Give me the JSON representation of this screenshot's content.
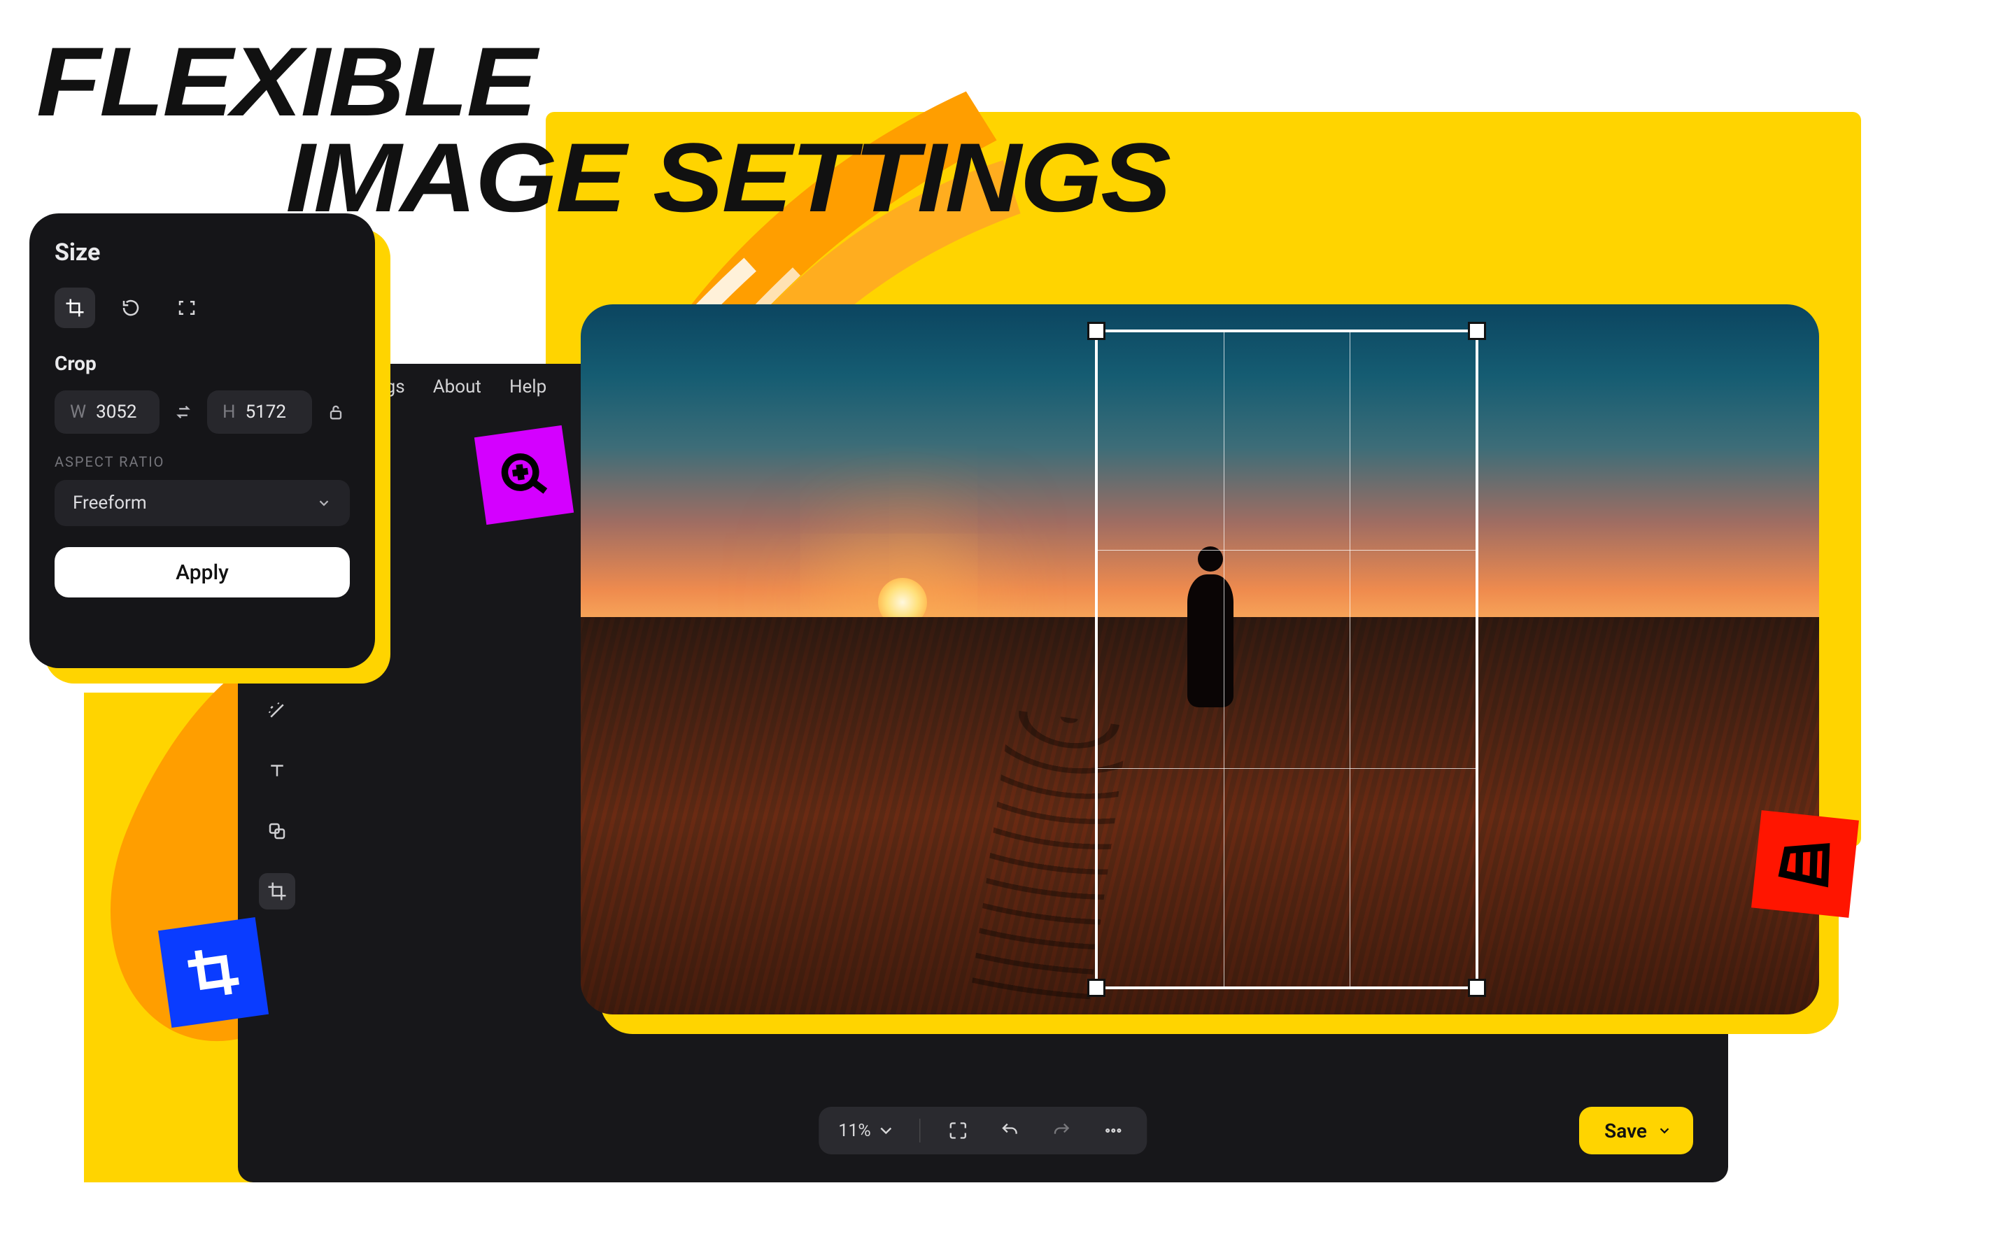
{
  "headline": {
    "line1": "FLEXIBLE",
    "line2": "IMAGE SETTINGS"
  },
  "editor": {
    "menu": {
      "settings": "ings",
      "about": "About",
      "help": "Help"
    },
    "zoom": "11%",
    "save_label": "Save"
  },
  "size_panel": {
    "title": "Size",
    "crop_label": "Crop",
    "width_label": "W",
    "width_value": "3052",
    "height_label": "H",
    "height_value": "5172",
    "aspect_ratio_label": "ASPECT RATIO",
    "aspect_ratio_value": "Freeform",
    "apply_label": "Apply"
  },
  "icons": {
    "crop": "crop-icon",
    "rotate": "rotate-icon",
    "fullscreen": "fullscreen-icon",
    "swap": "swap-icon",
    "lock": "lock-icon",
    "magic": "magic-icon",
    "text": "text-icon",
    "shape": "shape-icon",
    "zoom_in": "zoom-in-icon",
    "perspective": "perspective-crop-icon"
  }
}
